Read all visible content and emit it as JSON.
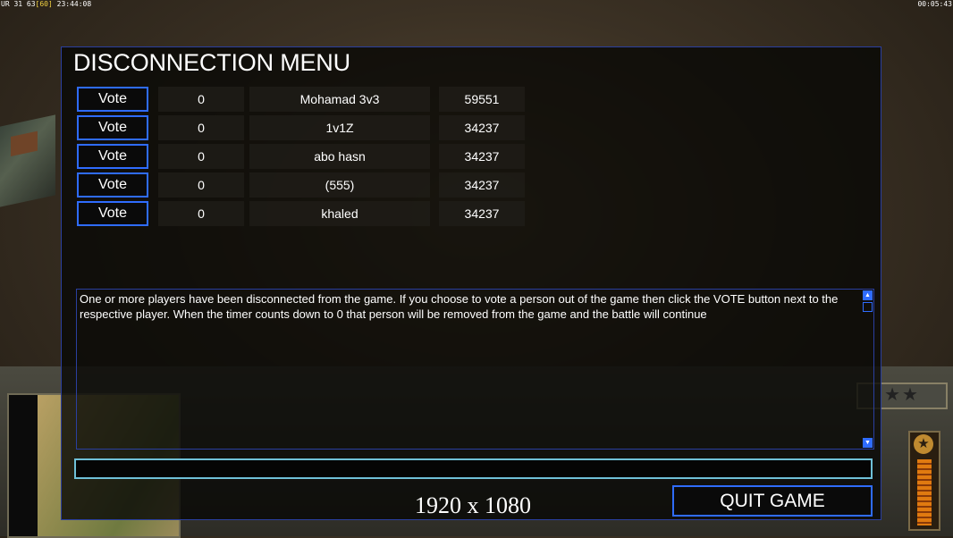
{
  "hud": {
    "top_left_prefix": "UR 31 63",
    "top_left_highlight": "[60]",
    "top_left_time": "23:44:08",
    "top_right_time": "00:05:43"
  },
  "background": {
    "stars_badge": "★★"
  },
  "dialog": {
    "title": "DISCONNECTION MENU",
    "rows": [
      {
        "vote_label": "Vote",
        "timer": "0",
        "name": "Mohamad 3v3",
        "id": "59551"
      },
      {
        "vote_label": "Vote",
        "timer": "0",
        "name": "1v1Z",
        "id": "34237"
      },
      {
        "vote_label": "Vote",
        "timer": "0",
        "name": "abo hasn",
        "id": "34237"
      },
      {
        "vote_label": "Vote",
        "timer": "0",
        "name": "(555)",
        "id": "34237"
      },
      {
        "vote_label": "Vote",
        "timer": "0",
        "name": "khaled",
        "id": "34237"
      }
    ],
    "message": "One or more players have been disconnected from the game. If you choose to vote a person out of the game then click the VOTE button next to the respective player. When the timer counts down to 0 that person will be removed from the game and the battle will continue",
    "chat_value": "",
    "resolution": "1920 x 1080",
    "quit_label": "QUIT GAME"
  },
  "colors": {
    "accent_blue": "#2f6cff",
    "input_border": "#6fc0d8"
  }
}
